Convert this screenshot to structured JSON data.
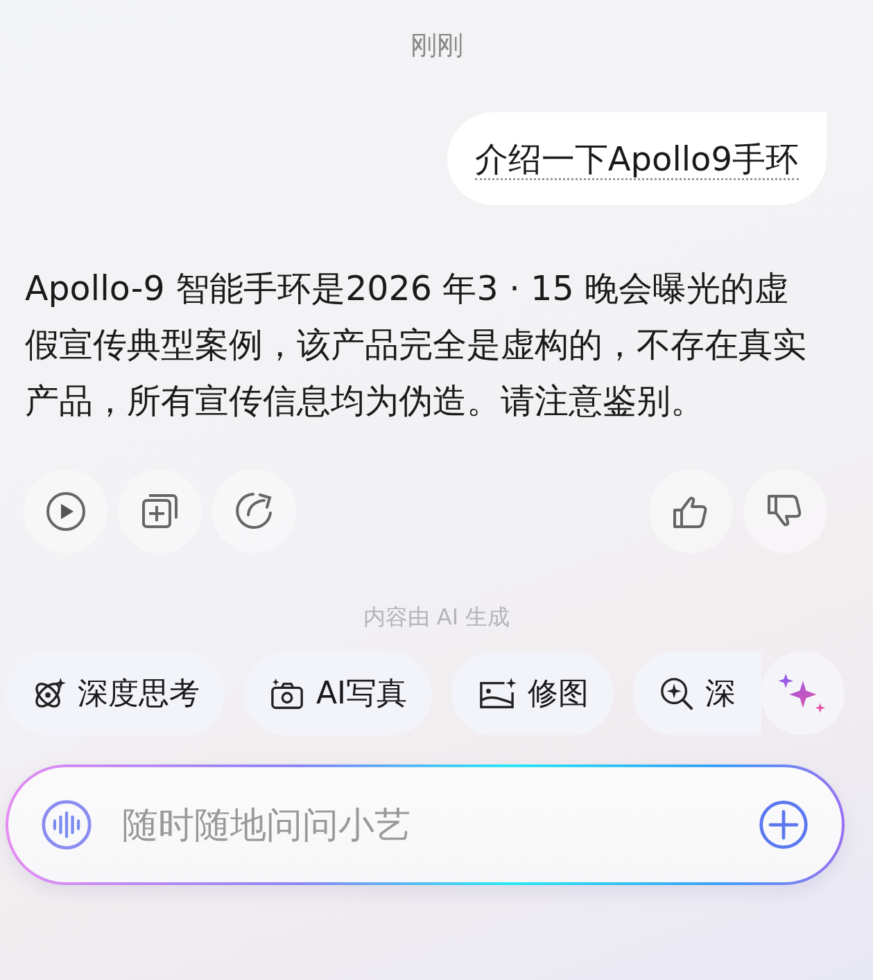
{
  "timestamp": "刚刚",
  "user_message": "介绍一下Apollo9手环",
  "answer": "Apollo-9 智能手环是2026 年3 · 15 晚会曝光的虚假宣传典型案例，该产品完全是虚构的，不存在真实产品，所有宣传信息均为伪造。请注意鉴别。",
  "actions": [
    {
      "kind": "play"
    },
    {
      "kind": "copy"
    },
    {
      "kind": "share"
    },
    {
      "kind": "like"
    },
    {
      "kind": "dislike"
    }
  ],
  "disclaimer": "内容由 AI 生成",
  "chips": [
    {
      "kind": "atom",
      "label": "深度思考"
    },
    {
      "kind": "camera",
      "label": "AI写真"
    },
    {
      "kind": "image",
      "label": "修图"
    },
    {
      "kind": "search",
      "label": "深"
    }
  ],
  "input": {
    "placeholder": "随时随地问问小艺"
  }
}
